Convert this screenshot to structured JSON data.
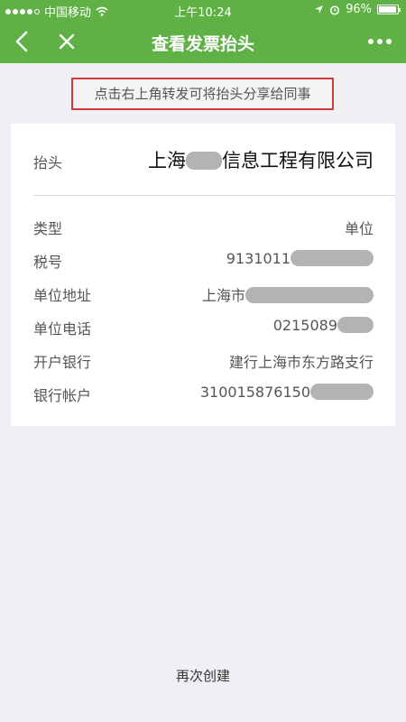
{
  "status_bar": {
    "carrier": "中国移动",
    "time": "上午10:24",
    "battery": "96%",
    "battery_level": 0.96
  },
  "nav": {
    "title": "查看发票抬头",
    "back_icon": "chevron-left-icon",
    "close_icon": "close-icon",
    "more_icon": "more-dots-icon"
  },
  "hint": "点击右上角转发可将抬头分享给同事",
  "invoice": {
    "header_label": "抬头",
    "header_value_prefix": "上海",
    "header_value_suffix": "信息工程有限公司",
    "rows": [
      {
        "label": "类型",
        "value": "单位"
      },
      {
        "label": "税号",
        "value": "9131011"
      },
      {
        "label": "单位地址",
        "value": "上海市"
      },
      {
        "label": "单位电话",
        "value": "0215089"
      },
      {
        "label": "开户银行",
        "value": "建行上海市东方路支行"
      },
      {
        "label": "银行帐户",
        "value": "310015876150"
      }
    ]
  },
  "footer": {
    "recreate_label": "再次创建"
  },
  "colors": {
    "brand_green": "#5fb145",
    "highlight_border": "#d03a3a",
    "background": "#efeff4"
  }
}
